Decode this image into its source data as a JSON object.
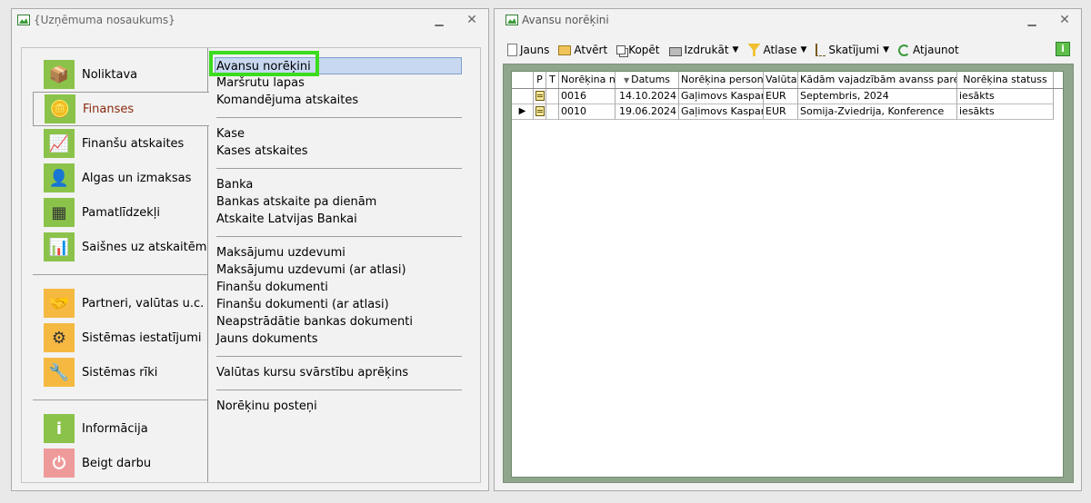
{
  "left_window": {
    "title": "{Uzņēmuma nosaukums}",
    "menu": [
      {
        "label": "Noliktava",
        "icon": "warehouse-icon"
      },
      {
        "label": "Finanses",
        "icon": "coins-icon",
        "active": true
      },
      {
        "label": "Finanšu atskaites",
        "icon": "finance-report-icon"
      },
      {
        "label": "Algas un izmaksas",
        "icon": "salary-icon"
      },
      {
        "label": "Pamatlīdzekļi",
        "icon": "assets-icon"
      },
      {
        "label": "Saišnes uz atskaitēm",
        "icon": "report-links-icon"
      }
    ],
    "menu2": [
      {
        "label": "Partneri, valūtas u.c.",
        "icon": "handshake-icon"
      },
      {
        "label": "Sistēmas iestatījumi",
        "icon": "settings-gears-icon"
      },
      {
        "label": "Sistēmas rīki",
        "icon": "tools-icon"
      }
    ],
    "menu3": [
      {
        "label": "Informācija",
        "icon": "info-icon"
      },
      {
        "label": "Beigt darbu",
        "icon": "power-icon"
      }
    ],
    "submenu_groups": [
      [
        "Avansu norēķini",
        "Maršrutu lapas",
        "Komandējuma atskaites"
      ],
      [
        "Kase",
        "Kases atskaites"
      ],
      [
        "Banka",
        "Bankas atskaite pa dienām",
        "Atskaite Latvijas Bankai"
      ],
      [
        "Maksājumu uzdevumi",
        "Maksājumu uzdevumi (ar atlasi)",
        "Finanšu dokumenti",
        "Finanšu dokumenti (ar atlasi)",
        "Neapstrādātie bankas dokumenti",
        "Jauns dokuments"
      ],
      [
        "Valūtas kursu svārstību aprēķins"
      ],
      [
        "Norēķinu posteņi"
      ]
    ]
  },
  "right_window": {
    "title": "Avansu norēķini",
    "toolbar": {
      "new": "Jauns",
      "open": "Atvērt",
      "copy": "Kopēt",
      "print": "Izdrukāt",
      "filter": "Atlase",
      "views": "Skatījumi",
      "refresh": "Atjaunot"
    },
    "columns": [
      "P",
      "T",
      "Norēķina nr.",
      "Datums",
      "Norēķina persona",
      "Valūta",
      "Kādām vajadzībām avanss paredzē",
      "Norēķina statuss"
    ],
    "rows": [
      {
        "nr": "0016",
        "date": "14.10.2024",
        "person": "Gaļimovs Kaspars",
        "currency": "EUR",
        "purpose": "Septembris, 2024",
        "status": "iesākts",
        "current": false
      },
      {
        "nr": "0010",
        "date": "19.06.2024",
        "person": "Gaļimovs Kaspars",
        "currency": "EUR",
        "purpose": "Somija-Zviedrija, Konference",
        "status": "iesākts",
        "current": true
      }
    ]
  }
}
